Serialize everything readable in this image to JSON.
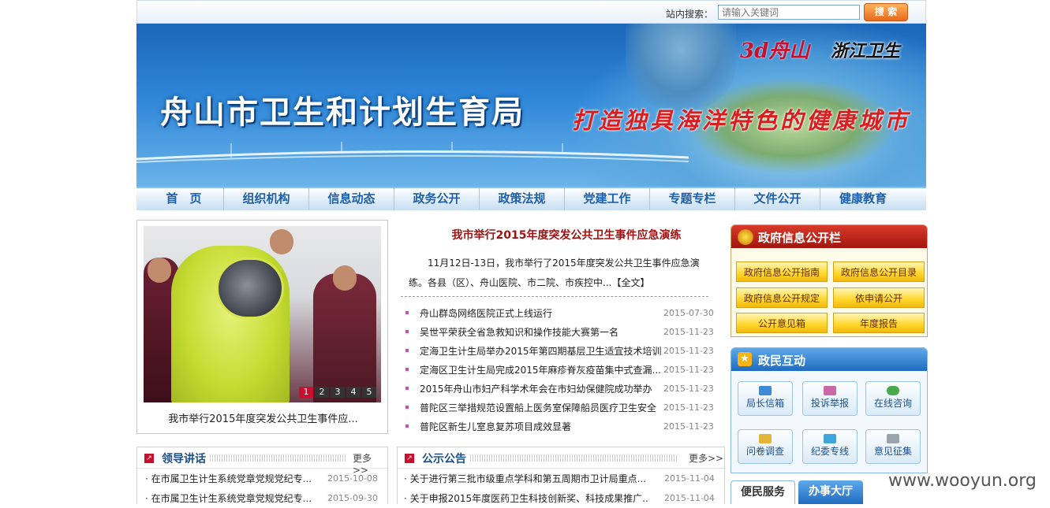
{
  "search": {
    "label": "站内搜索：",
    "placeholder": "请输入关键词",
    "button": "搜 索"
  },
  "banner": {
    "title": "舟山市卫生和计划生育局",
    "slogan": "打造独具海洋特色的健康城市",
    "logo1": "3d舟山",
    "logo2": "浙江卫生"
  },
  "nav": [
    "首　页",
    "组织机构",
    "信息动态",
    "政务公开",
    "政策法规",
    "党建工作",
    "专题专栏",
    "文件公开",
    "健康教育"
  ],
  "slide": {
    "caption": "我市举行2015年度突发公共卫生事件应...",
    "pages": [
      "1",
      "2",
      "3",
      "4",
      "5"
    ]
  },
  "headline": {
    "title": "我市举行2015年度突发公共卫生事件应急演练",
    "summary": "11月12日-13日，我市举行了2015年度突发公共卫生事件应急演练。各县（区）、舟山医院、市二院、市疾控中...",
    "more": "【全文】"
  },
  "news": [
    {
      "title": "舟山群岛网络医院正式上线运行",
      "date": "2015-07-30"
    },
    {
      "title": "吴世平荣获全省急救知识和操作技能大赛第一名",
      "date": "2015-11-23"
    },
    {
      "title": "定海卫生计生局举办2015年第四期基层卫生适宜技术培训",
      "date": "2015-11-23"
    },
    {
      "title": "定海区卫生计生局完成2015年麻疹脊灰疫苗集中式查漏...",
      "date": "2015-11-23"
    },
    {
      "title": "2015年舟山市妇产科学术年会在市妇幼保健院成功举办",
      "date": "2015-11-23"
    },
    {
      "title": "普陀区三举措规范设置船上医务室保障船员医疗卫生安全",
      "date": "2015-11-23"
    },
    {
      "title": "普陀区新生儿室息复苏项目成效显著",
      "date": "2015-11-23"
    }
  ],
  "gov": {
    "title": "政府信息公开栏",
    "buttons": [
      "政府信息公开指南",
      "政府信息公开目录",
      "政府信息公开规定",
      "依申请公开",
      "公开意见箱",
      "年度报告"
    ]
  },
  "interact": {
    "title": "政民互动",
    "buttons": [
      "局长信箱",
      "投诉举报",
      "在线咨询",
      "问卷调查",
      "纪委专线",
      "意见征集"
    ]
  },
  "service_tabs": [
    "便民服务",
    "办事大厅"
  ],
  "leader": {
    "title": "领导讲话",
    "more": "更多>>",
    "rows": [
      {
        "title": "· 在市属卫生计生系统党章党规党纪专...",
        "date": "2015-10-08"
      },
      {
        "title": "· 在市属卫生计生系统党章党规党纪专...",
        "date": "2015-09-30"
      }
    ]
  },
  "notice": {
    "title": "公示公告",
    "more": "更多>>",
    "rows": [
      {
        "title": "· 关于进行第三批市级重点学科和第五周期市卫计局重点...",
        "date": "2015-11-04"
      },
      {
        "title": "· 关于申报2015年度医药卫生科技创新奖、科技成果推广...",
        "date": "2015-11-04"
      }
    ]
  },
  "watermark": "www.wooyun.org",
  "colors": {
    "nav_text": "#1d5fa8",
    "headline": "#a01212",
    "gov_head": "#c0281b",
    "interact_head": "#2f7fd0"
  }
}
